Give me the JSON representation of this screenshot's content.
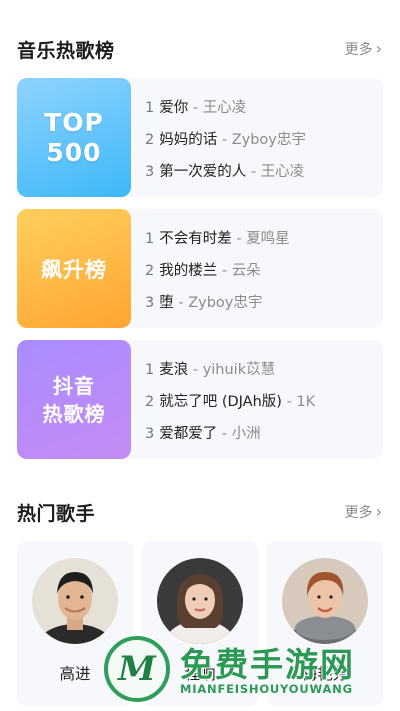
{
  "charts_section": {
    "title": "音乐热歌榜",
    "more_label": "更多"
  },
  "charts": [
    {
      "cover_lines": [
        "TOP",
        "500"
      ],
      "songs": [
        {
          "rank": "1",
          "title": "爱你",
          "artist": "王心凌"
        },
        {
          "rank": "2",
          "title": "妈妈的话",
          "artist": "Zyboy忠宇"
        },
        {
          "rank": "3",
          "title": "第一次爱的人",
          "artist": "王心凌"
        }
      ]
    },
    {
      "cover_lines": [
        "飙升榜"
      ],
      "songs": [
        {
          "rank": "1",
          "title": "不会有时差",
          "artist": "夏鸣星"
        },
        {
          "rank": "2",
          "title": "我的楼兰",
          "artist": "云朵"
        },
        {
          "rank": "3",
          "title": "堕",
          "artist": "Zyboy忠宇"
        }
      ]
    },
    {
      "cover_lines": [
        "抖音",
        "热歌榜"
      ],
      "songs": [
        {
          "rank": "1",
          "title": "麦浪",
          "artist": "yihuik苡慧"
        },
        {
          "rank": "2",
          "title": "就忘了吧 (DJAh版)",
          "artist": "1K"
        },
        {
          "rank": "3",
          "title": "爱都爱了",
          "artist": "小洲"
        }
      ]
    }
  ],
  "song_separator": "-",
  "singers_section": {
    "title": "热门歌手",
    "more_label": "更多"
  },
  "singers": [
    {
      "name": "高进"
    },
    {
      "name": "程响"
    },
    {
      "name": "梅艳芳"
    }
  ],
  "watermark": {
    "logo_letter": "M",
    "title": "免费手游网",
    "subtitle": "MIANFEISHOUYOUWANG"
  }
}
